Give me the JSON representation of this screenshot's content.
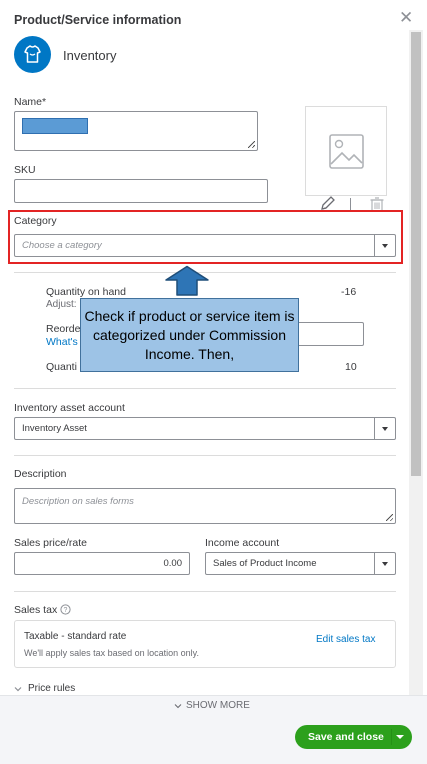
{
  "panel": {
    "title": "Product/Service information",
    "item_type": "Inventory",
    "item_type_icon": "shirt-icon"
  },
  "fields": {
    "name_label": "Name*",
    "sku_label": "SKU",
    "category_label": "Category",
    "category_placeholder": "Choose a category",
    "quantity_on_hand_label": "Quantity on hand",
    "quantity_on_hand_value": "-16",
    "adjust_label": "Adjust:",
    "reorder_label": "Reorde",
    "whats_link": "What's",
    "quantity_label": "Quanti",
    "quantity_value": "10",
    "inventory_asset_label": "Inventory asset account",
    "inventory_asset_value": "Inventory Asset",
    "description_label": "Description",
    "description_placeholder": "Description on sales forms",
    "sales_price_label": "Sales price/rate",
    "sales_price_value": "0.00",
    "income_account_label": "Income account",
    "income_account_value": "Sales of Product Income",
    "sales_tax_label": "Sales tax",
    "tax_name": "Taxable - standard rate",
    "tax_note": "We'll apply sales tax based on location only.",
    "edit_sales_tax": "Edit sales tax",
    "price_rules_label": "Price rules"
  },
  "footer": {
    "show_more": "SHOW MORE",
    "save_and_close": "Save and close"
  },
  "annotation": {
    "callout_text": "Check if product or service item is categorized under Commission Income. Then,"
  },
  "colors": {
    "accent_blue": "#0077c5",
    "save_green": "#2ca01c",
    "highlight_red": "#e32424",
    "callout_fill": "#9dc3e6",
    "redacted_fill": "#5b9bd5"
  }
}
